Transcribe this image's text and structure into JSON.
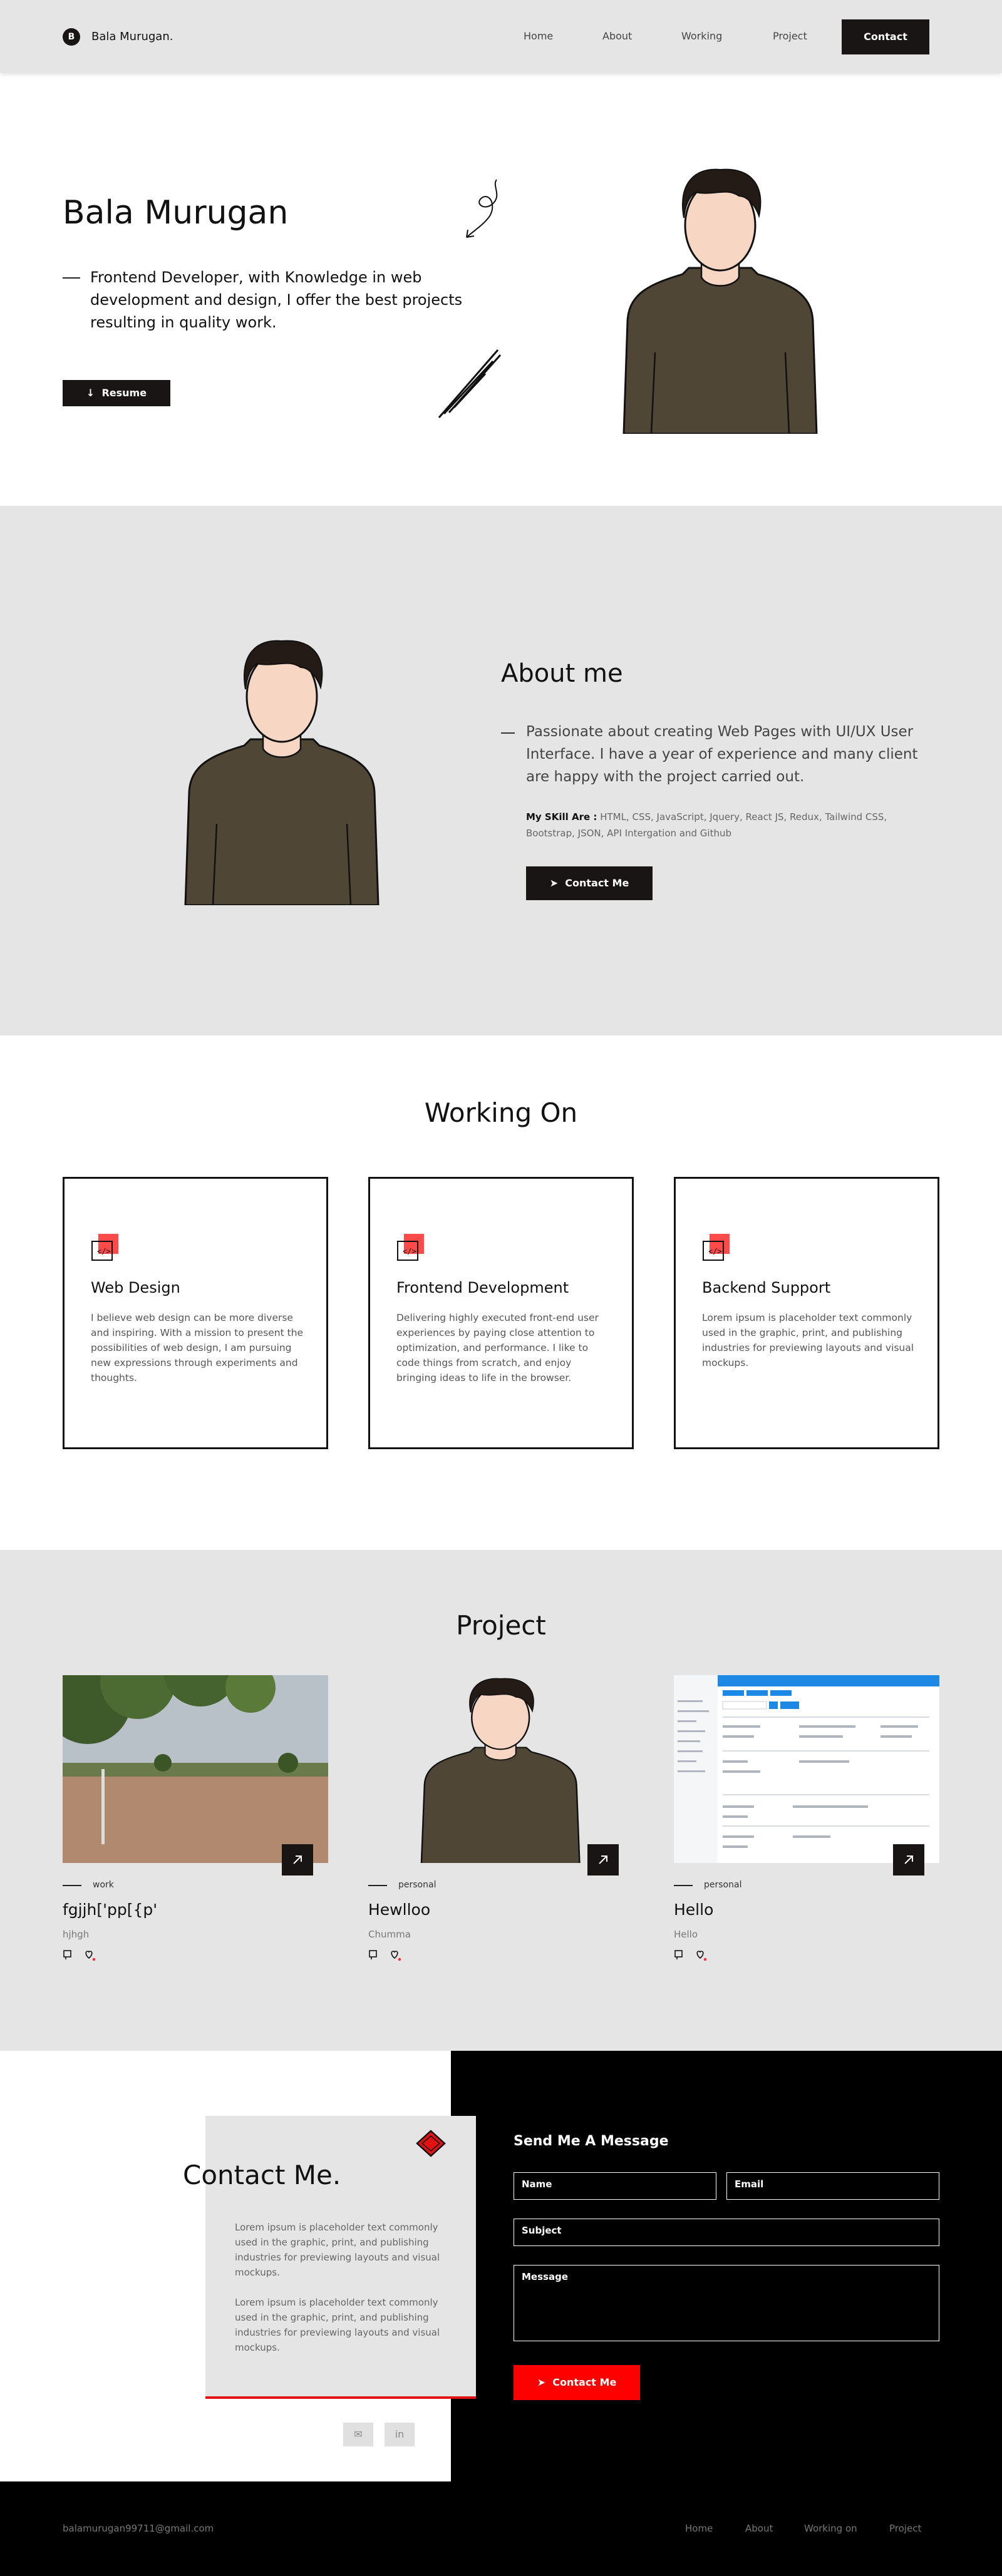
{
  "nav": {
    "logo_letter": "B",
    "logo_text": "Bala Murugan.",
    "links": [
      "Home",
      "About",
      "Working",
      "Project"
    ],
    "contact_label": "Contact"
  },
  "hero": {
    "title": "Bala Murugan",
    "description": "Frontend Developer, with Knowledge in web development and design, I offer the best projects resulting in quality work.",
    "resume_label": "Resume"
  },
  "about": {
    "title": "About me",
    "description": "Passionate about creating Web Pages with UI/UX User Interface. I have a year of experience and many client are happy with the project carried out.",
    "skill_label": "My SKill Are :",
    "skills": "HTML, CSS, JavaScript, Jquery, React JS, Redux, Tailwind CSS, Bootstrap, JSON, API Intergation and Github",
    "button_label": "Contact Me"
  },
  "working": {
    "title": "Working On",
    "cards": [
      {
        "title": "Web Design",
        "desc": "I believe web design can be more diverse and inspiring. With a mission to present the possibilities of web design, I am pursuing new expressions through experiments and thoughts."
      },
      {
        "title": "Frontend Development",
        "desc": "Delivering highly executed front-end user experiences by paying close attention to optimization, and performance. I like to code things from scratch, and enjoy bringing ideas to life in the browser."
      },
      {
        "title": "Backend Support",
        "desc": "Lorem ipsum is placeholder text commonly used in the graphic, print, and publishing industries for previewing layouts and visual mockups."
      }
    ]
  },
  "project": {
    "title": "Project",
    "items": [
      {
        "category": "work",
        "name": "fgjjh['pp[{p'",
        "sub": "hjhgh"
      },
      {
        "category": "personal",
        "name": "Hewlloo",
        "sub": "Chumma"
      },
      {
        "category": "personal",
        "name": "Hello",
        "sub": "Hello"
      }
    ]
  },
  "contact": {
    "title": "Contact Me.",
    "para1": "Lorem ipsum is placeholder text commonly used in the graphic, print, and publishing industries for previewing layouts and visual mockups.",
    "para2": "Lorem ipsum is placeholder text commonly used in the graphic, print, and publishing industries for previewing layouts and visual mockups.",
    "social": [
      "mail-icon",
      "linkedin-icon"
    ],
    "linkedin_text": "in",
    "form_title": "Send Me A Message",
    "name_placeholder": "Name",
    "email_placeholder": "Email",
    "subject_placeholder": "Subject",
    "message_placeholder": "Message",
    "send_label": "Contact Me"
  },
  "footer": {
    "email": "balamurugan99711@gmail.com",
    "links": [
      "Home",
      "About",
      "Working on",
      "Project"
    ]
  },
  "colors": {
    "dark": "#1a1515",
    "gray": "#e5e5e5",
    "accent": "#ff0000"
  }
}
